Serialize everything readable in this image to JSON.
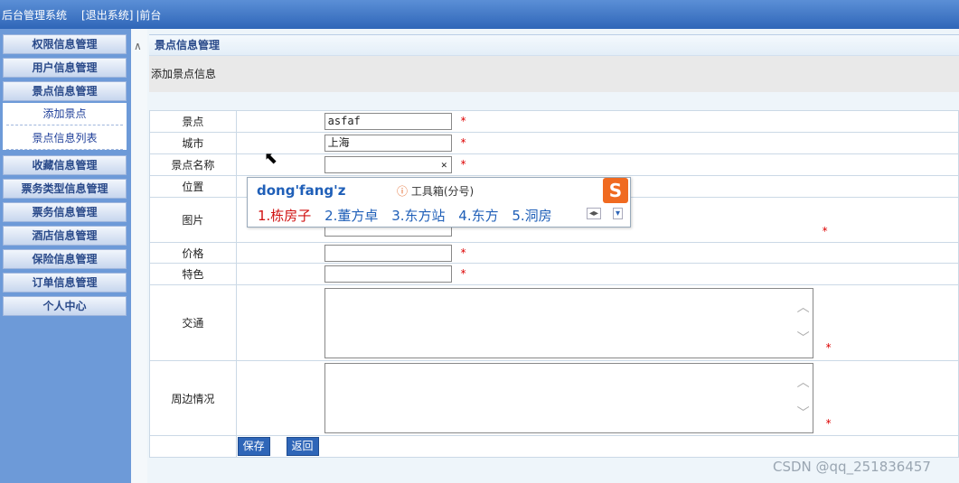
{
  "header": {
    "title": "后台管理系统",
    "logout": "[退出系统]",
    "front": "|前台"
  },
  "sidebar": {
    "items": [
      "权限信息管理",
      "用户信息管理",
      "景点信息管理",
      "收藏信息管理",
      "票务类型信息管理",
      "票务信息管理",
      "酒店信息管理",
      "保险信息管理",
      "订单信息管理",
      "个人中心"
    ],
    "sub_items": [
      "添加景点",
      "景点信息列表"
    ]
  },
  "section": {
    "title": "景点信息管理",
    "subtitle": "添加景点信息"
  },
  "form": {
    "labels": [
      "景点",
      "城市",
      "景点名称",
      "位置",
      "图片",
      "价格",
      "特色",
      "交通",
      "周边情况"
    ],
    "values": {
      "jingdian": "asfaf",
      "city": "上海"
    },
    "required_mark": "*",
    "clear_glyph": "✕",
    "save_label": "保存",
    "back_label": "返回"
  },
  "ime": {
    "pinyin": "dong'fang'z",
    "toolbox": "工具箱(分号)",
    "candidates": [
      "1.栋房子",
      "2.董方卓",
      "3.东方站",
      "4.东方",
      "5.洞房"
    ],
    "logo": "S"
  },
  "watermark": "CSDN @qq_251836457"
}
